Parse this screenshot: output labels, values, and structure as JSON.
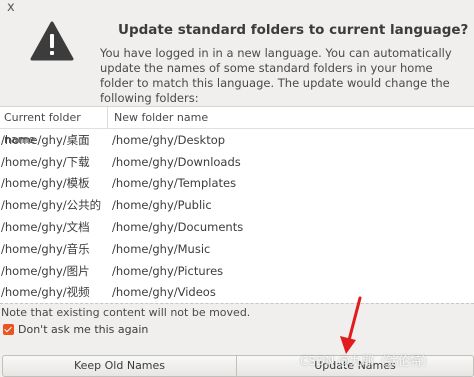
{
  "dialog": {
    "close_glyph": "x",
    "title": "Update standard folders to current language?",
    "description": "You have logged in in a new language. You can automatically update the names of some standard folders in your home folder to match this language. The update would change the following folders:"
  },
  "table": {
    "headers": [
      "Current folder name",
      "New folder name"
    ],
    "rows": [
      [
        "/home/ghy/桌面",
        "/home/ghy/Desktop"
      ],
      [
        "/home/ghy/下载",
        "/home/ghy/Downloads"
      ],
      [
        "/home/ghy/模板",
        "/home/ghy/Templates"
      ],
      [
        "/home/ghy/公共的",
        "/home/ghy/Public"
      ],
      [
        "/home/ghy/文档",
        "/home/ghy/Documents"
      ],
      [
        "/home/ghy/音乐",
        "/home/ghy/Music"
      ],
      [
        "/home/ghy/图片",
        "/home/ghy/Pictures"
      ],
      [
        "/home/ghy/视频",
        "/home/ghy/Videos"
      ]
    ]
  },
  "note": "Note that existing content will not be moved.",
  "checkbox": {
    "label": "Don't ask me this again",
    "checked": true
  },
  "buttons": {
    "keep": "Keep Old Names",
    "update": "Update Names"
  },
  "watermark": "CSDN @九耶（钛伦特）",
  "icons": {
    "warning": "warning-icon",
    "arrow": "red-arrow-annotation"
  },
  "colors": {
    "accent": "#e95420",
    "annotation": "#e01c1c"
  }
}
